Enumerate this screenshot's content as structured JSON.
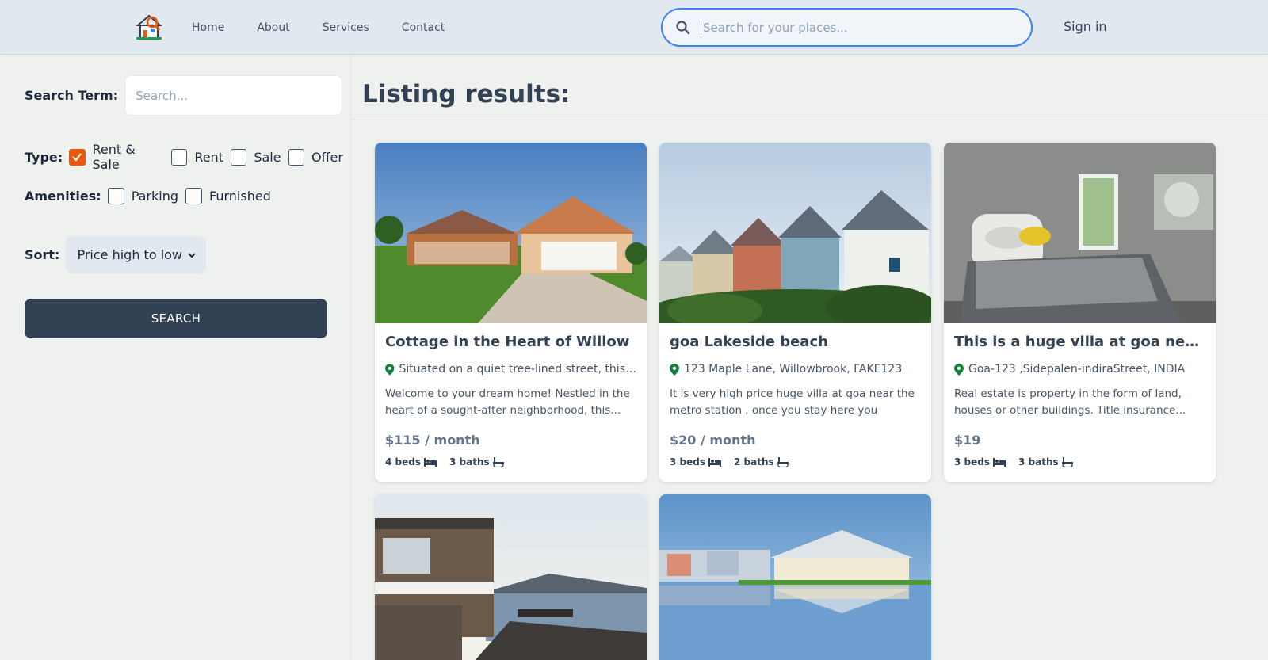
{
  "nav": {
    "items": [
      "Home",
      "About",
      "Services",
      "Contact"
    ],
    "search_placeholder": "Search for your places...",
    "signin": "Sign in"
  },
  "sidebar": {
    "search_term_label": "Search Term:",
    "search_placeholder": "Search...",
    "type_label": "Type:",
    "type_options": [
      {
        "label": "Rent & Sale",
        "checked": true
      },
      {
        "label": "Rent",
        "checked": false
      },
      {
        "label": "Sale",
        "checked": false
      },
      {
        "label": "Offer",
        "checked": false
      }
    ],
    "amenities_label": "Amenities:",
    "amenities": [
      {
        "label": "Parking",
        "checked": false
      },
      {
        "label": "Furnished",
        "checked": false
      }
    ],
    "sort_label": "Sort:",
    "sort_value": "Price high to low",
    "search_button": "SEARCH"
  },
  "main": {
    "title": "Listing results:",
    "listings": [
      {
        "title": "Cottage in the Heart of Willow",
        "address": "Situated on a quiet tree-lined street, this pr...",
        "description": "Welcome to your dream home! Nestled in the heart of a sought-after neighborhood, this...",
        "price": "$115 / month",
        "beds": "4 beds",
        "baths": "3 baths"
      },
      {
        "title": "goa Lakeside beach",
        "address": "123 Maple Lane, Willowbrook, FAKE123",
        "description": "It is very high price huge villa at goa near the metro station , once you stay here you gonna...",
        "price": "$20 / month",
        "beds": "3 beds",
        "baths": "2 baths"
      },
      {
        "title": "This is a huge villa at goa near acean",
        "address": "Goa-123 ,Sidepalen-indiraStreet, INDIA",
        "description": "Real estate is property in the form of land, houses or other buildings. Title insurance...",
        "price": "$19",
        "beds": "3 beds",
        "baths": "3 baths"
      }
    ]
  },
  "colors": {
    "accent": "#3b82f6",
    "checkbox": "#ea580c",
    "button": "#334155",
    "pin": "#15803d"
  }
}
